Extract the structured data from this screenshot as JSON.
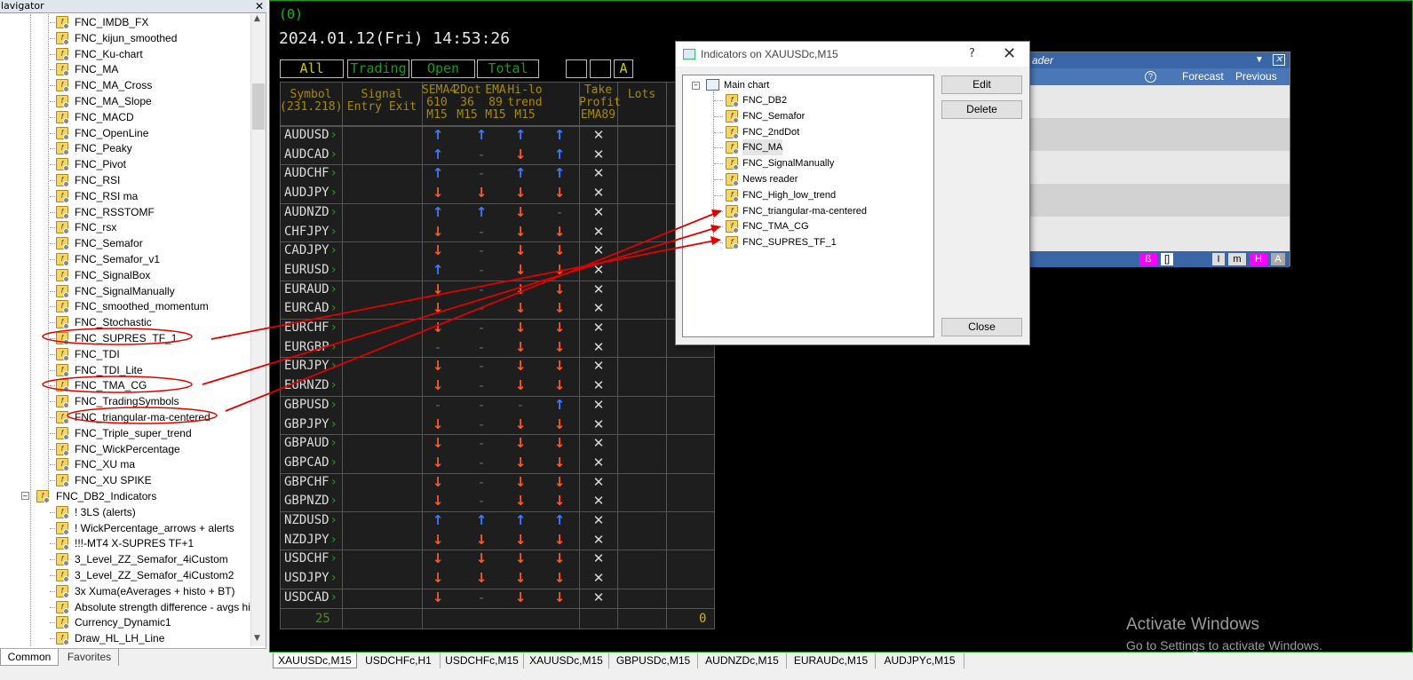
{
  "navigator": {
    "title": "Navigator",
    "visible_title": "lavigator",
    "items": [
      "FNC_IMDB_FX",
      "FNC_kijun_smoothed",
      "FNC_Ku-chart",
      "FNC_MA",
      "FNC_MA_Cross",
      "FNC_MA_Slope",
      "FNC_MACD",
      "FNC_OpenLine",
      "FNC_Peaky",
      "FNC_Pivot",
      "FNC_RSI",
      "FNC_RSI ma",
      "FNC_RSSTOMF",
      "FNC_rsx",
      "FNC_Semafor",
      "FNC_Semafor_v1",
      "FNC_SignalBox",
      "FNC_SignalManually",
      "FNC_smoothed_momentum",
      "FNC_Stochastic",
      "FNC_SUPRES_TF_1",
      "FNC_TDI",
      "FNC_TDI_Lite",
      "FNC_TMA_CG",
      "FNC_TradingSymbols",
      "FNC_triangular-ma-centered",
      "FNC_Triple_super_trend",
      "FNC_WickPercentage",
      "FNC_XU ma",
      "FNC_XU SPIKE"
    ],
    "folder": "FNC_DB2_Indicators",
    "folder_items": [
      "! 3LS (alerts)",
      "! WickPercentage_arrows + alerts",
      "!!!-MT4 X-SUPRES TF+1",
      "3_Level_ZZ_Semafor_4iCustom",
      "3_Level_ZZ_Semafor_4iCustom2",
      "3x Xuma(eAverages + histo + BT)",
      "Absolute strength difference - avgs hi",
      "Currency_Dynamic1",
      "Draw_HL_LH_Line"
    ],
    "tabs": [
      "Common",
      "Favorites"
    ]
  },
  "chart": {
    "label": "(0)",
    "datetime": "2024.01.12(Fri) 14:53:26",
    "filters": [
      "All",
      "Trading",
      "Open",
      "Total",
      "",
      "",
      "A"
    ],
    "headers": {
      "symbol": [
        "Symbol",
        "(231.218)"
      ],
      "signal": [
        "Signal",
        "Entry Exit"
      ],
      "sema": [
        "SEMA4",
        "610",
        "M15"
      ],
      "dot": [
        "2Dot",
        "36",
        "M15"
      ],
      "ema": [
        "EMA",
        "89",
        "M15"
      ],
      "hilo": [
        "Hi-lo",
        "trend",
        "M15"
      ],
      "tp": [
        "Take",
        "Profit",
        "EMA89"
      ],
      "lots": [
        "Lots"
      ]
    },
    "rows": [
      {
        "s": "AUDUSD",
        "a": [
          "u",
          "u",
          "u",
          "u"
        ]
      },
      {
        "s": "AUDCAD",
        "a": [
          "u",
          "-",
          "d",
          "u"
        ]
      },
      {
        "s": "AUDCHF",
        "a": [
          "u",
          "-",
          "u",
          "u"
        ]
      },
      {
        "s": "AUDJPY",
        "a": [
          "d",
          "d",
          "d",
          "d"
        ]
      },
      {
        "s": "AUDNZD",
        "a": [
          "u",
          "u",
          "d",
          "-"
        ]
      },
      {
        "s": "CHFJPY",
        "a": [
          "d",
          "-",
          "d",
          "d"
        ]
      },
      {
        "s": "CADJPY",
        "a": [
          "d",
          "-",
          "d",
          "d"
        ]
      },
      {
        "s": "EURUSD",
        "a": [
          "u",
          "-",
          "d",
          "d"
        ]
      },
      {
        "s": "EURAUD",
        "a": [
          "d",
          "-",
          "d",
          "d"
        ]
      },
      {
        "s": "EURCAD",
        "a": [
          "d",
          "-",
          "d",
          "d"
        ]
      },
      {
        "s": "EURCHF",
        "a": [
          "d",
          "-",
          "d",
          "d"
        ]
      },
      {
        "s": "EURGBP",
        "a": [
          "-",
          "-",
          "d",
          "d"
        ]
      },
      {
        "s": "EURJPY",
        "a": [
          "d",
          "-",
          "d",
          "d"
        ]
      },
      {
        "s": "EURNZD",
        "a": [
          "d",
          "-",
          "d",
          "d"
        ]
      },
      {
        "s": "GBPUSD",
        "a": [
          "-",
          "-",
          "-",
          "u"
        ]
      },
      {
        "s": "GBPJPY",
        "a": [
          "d",
          "-",
          "d",
          "d"
        ]
      },
      {
        "s": "GBPAUD",
        "a": [
          "d",
          "-",
          "d",
          "d"
        ]
      },
      {
        "s": "GBPCAD",
        "a": [
          "d",
          "-",
          "d",
          "d"
        ]
      },
      {
        "s": "GBPCHF",
        "a": [
          "d",
          "-",
          "d",
          "d"
        ]
      },
      {
        "s": "GBPNZD",
        "a": [
          "d",
          "-",
          "d",
          "d"
        ]
      },
      {
        "s": "NZDUSD",
        "a": [
          "u",
          "u",
          "u",
          "u"
        ]
      },
      {
        "s": "NZDJPY",
        "a": [
          "d",
          "d",
          "d",
          "d"
        ]
      },
      {
        "s": "USDCHF",
        "a": [
          "d",
          "d",
          "d",
          "d"
        ]
      },
      {
        "s": "USDJPY",
        "a": [
          "d",
          "d",
          "d",
          "d"
        ]
      },
      {
        "s": "USDCAD",
        "a": [
          "d",
          "-",
          "d",
          "d"
        ]
      }
    ],
    "footer_count": "25",
    "footer_lots": "0"
  },
  "news": {
    "title_fragment": "ader",
    "forecast": "Forecast",
    "previous": "Previous",
    "bottom_buttons": [
      "",
      "[]",
      "I",
      "m",
      "H",
      "A"
    ]
  },
  "dialog": {
    "title": "Indicators on XAUUSDc,M15",
    "help": "?",
    "close_x": "✕",
    "root": "Main chart",
    "items": [
      "FNC_DB2",
      "FNC_Semafor",
      "FNC_2ndDot",
      "FNC_MA",
      "FNC_SignalManually",
      "News reader",
      "FNC_High_low_trend",
      "FNC_triangular-ma-centered",
      "FNC_TMA_CG",
      "FNC_SUPRES_TF_1"
    ],
    "buttons": {
      "edit": "Edit",
      "delete": "Delete",
      "close": "Close"
    }
  },
  "tabs": [
    "XAUUSDc,M15",
    "USDCHFc,H1",
    "USDCHFc,M15",
    "XAUUSDc,M15",
    "GBPUSDc,M15",
    "AUDNZDc,M15",
    "EURAUDc,M15",
    "AUDJPYc,M15"
  ],
  "activation": {
    "line1": "Activate Windows",
    "line2": "Go to Settings to activate Windows."
  },
  "colors": {
    "up": "#3f7bff",
    "down": "#ff5a1f",
    "annotation": "#e00000",
    "chart_border": "#1c9a1c"
  }
}
